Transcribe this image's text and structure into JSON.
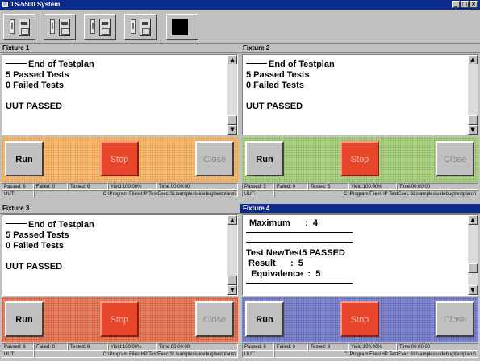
{
  "window": {
    "title": "TS-5500 System",
    "controls": [
      "_",
      "□",
      "×"
    ]
  },
  "toolbar": {
    "buttons": [
      "fixture-tool-1",
      "fixture-tool-2",
      "fixture-tool-3",
      "fixture-tool-4",
      "stop-all"
    ]
  },
  "colors": {
    "orange": "#f7c47f",
    "green": "#b7d98f",
    "red": "#ee8a6a",
    "blue": "#8d93d6",
    "stop": "#e8462b"
  },
  "fixtures": [
    {
      "title": "Fixture 1",
      "log": [
        "End of Testplan",
        "5 Passed Tests",
        "0 Failed Tests",
        "",
        "UUT PASSED"
      ],
      "run_label": "Run",
      "stop_label": "Stop",
      "close_label": "Close",
      "passed": "Passed: 6",
      "failed": "Failed: 0",
      "tested": "Tested: 6",
      "yield": "Yield:100.00%",
      "time": "Time:00:00:00",
      "uut": "UUT:",
      "path": "C:\\Program Files\\HP TestExec SL\\samples\\uidebug\\testplans\\"
    },
    {
      "title": "Fixture 2",
      "log": [
        "End of Testplan",
        "5 Passed Tests",
        "0 Failed Tests",
        "",
        "UUT PASSED"
      ],
      "run_label": "Run",
      "stop_label": "Stop",
      "close_label": "Close",
      "passed": "Passed: 5",
      "failed": "Failed: 0",
      "tested": "Tested: 5",
      "yield": "Yield:100.00%",
      "time": "Time:00:00:00",
      "uut": "UUT:",
      "path": "C:\\Program Files\\HP TestExec SL\\samples\\uidebug\\testplans\\"
    },
    {
      "title": "Fixture 3",
      "log": [
        "End of Testplan",
        "5 Passed Tests",
        "0 Failed Tests",
        "",
        "UUT PASSED"
      ],
      "run_label": "Run",
      "stop_label": "Stop",
      "close_label": "Close",
      "passed": "Passed: 6",
      "failed": "Failed: 0",
      "tested": "Tested: 6",
      "yield": "Yield:100.00%",
      "time": "Time:00:00:00",
      "uut": "UUT:",
      "path": "C:\\Program Files\\HP TestExec SL\\samples\\uidebug\\testplans\\"
    },
    {
      "title": "Fixture 4",
      "log": [
        "Maximum      :  4",
        "",
        "Test NewTest5 PASSED",
        " Result      :  5",
        "  Equivalence  :  5"
      ],
      "run_label": "Run",
      "stop_label": "Stop",
      "close_label": "Close",
      "passed": "Passed: 8",
      "failed": "Failed: 0",
      "tested": "Tested: 8",
      "yield": "Yield:100.00%",
      "time": "Time:00:00:00",
      "uut": "UUT:",
      "path": "C:\\Program Files\\HP TestExec SL\\samples\\uidebug\\testplans\\"
    }
  ]
}
